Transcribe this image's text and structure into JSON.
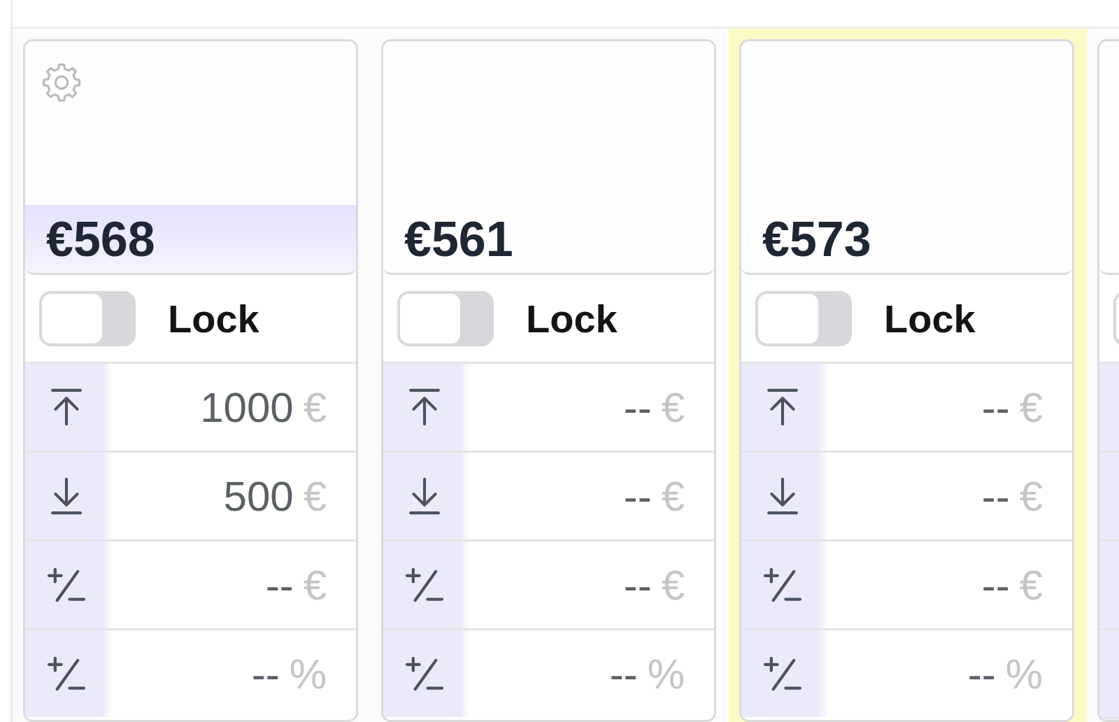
{
  "columns": [
    {
      "kind": "card",
      "selected": false,
      "settings_icon": true,
      "price": "€568",
      "price_highlighted": true,
      "lock": {
        "label": "Lock",
        "on": false
      },
      "fields": [
        {
          "kind": "ceiling",
          "value": "1000",
          "unit": "€"
        },
        {
          "kind": "floor",
          "value": "500",
          "unit": "€"
        },
        {
          "kind": "offset",
          "value": "--",
          "unit": "€"
        },
        {
          "kind": "offset",
          "value": "--",
          "unit": "%"
        }
      ]
    },
    {
      "kind": "card",
      "selected": false,
      "settings_icon": false,
      "price": "€561",
      "price_highlighted": false,
      "lock": {
        "label": "Lock",
        "on": false
      },
      "fields": [
        {
          "kind": "ceiling",
          "value": "--",
          "unit": "€"
        },
        {
          "kind": "floor",
          "value": "--",
          "unit": "€"
        },
        {
          "kind": "offset",
          "value": "--",
          "unit": "€"
        },
        {
          "kind": "offset",
          "value": "--",
          "unit": "%"
        }
      ]
    },
    {
      "kind": "card",
      "selected": true,
      "settings_icon": false,
      "price": "€573",
      "price_highlighted": false,
      "lock": {
        "label": "Lock",
        "on": false
      },
      "fields": [
        {
          "kind": "ceiling",
          "value": "--",
          "unit": "€"
        },
        {
          "kind": "floor",
          "value": "--",
          "unit": "€"
        },
        {
          "kind": "offset",
          "value": "--",
          "unit": "€"
        },
        {
          "kind": "offset",
          "value": "--",
          "unit": "%"
        }
      ]
    },
    {
      "kind": "cut",
      "selected": false,
      "lock": {
        "on": false
      }
    }
  ]
}
